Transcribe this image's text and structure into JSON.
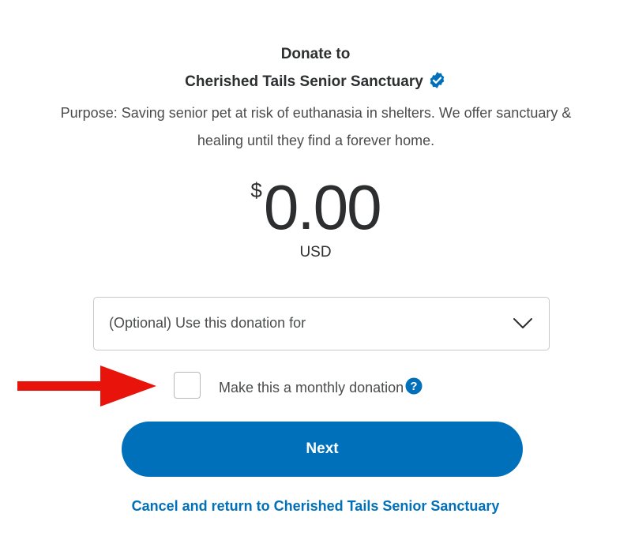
{
  "header": {
    "donate_to": "Donate to",
    "organization": "Cherished Tails Senior Sanctuary",
    "verified_icon": "verified-checkmark-icon",
    "purpose": "Purpose: Saving senior pet at risk of euthanasia in shelters. We offer sanctuary & healing until they find a forever home."
  },
  "donation": {
    "currency_symbol": "$",
    "amount": "0.00",
    "currency_code": "USD"
  },
  "designation": {
    "placeholder": "(Optional) Use this donation for",
    "icon": "chevron-down-icon"
  },
  "monthly": {
    "label": "Make this a monthly donation",
    "checked": false,
    "help_icon": "question-circle-icon"
  },
  "annotation": {
    "icon": "red-arrow-icon",
    "color": "#e8140c"
  },
  "actions": {
    "next_label": "Next",
    "cancel_link": "Cancel and return to Cherished Tails Senior Sanctuary"
  },
  "colors": {
    "brand_blue": "#0070ba",
    "text": "#2c2e2f"
  }
}
